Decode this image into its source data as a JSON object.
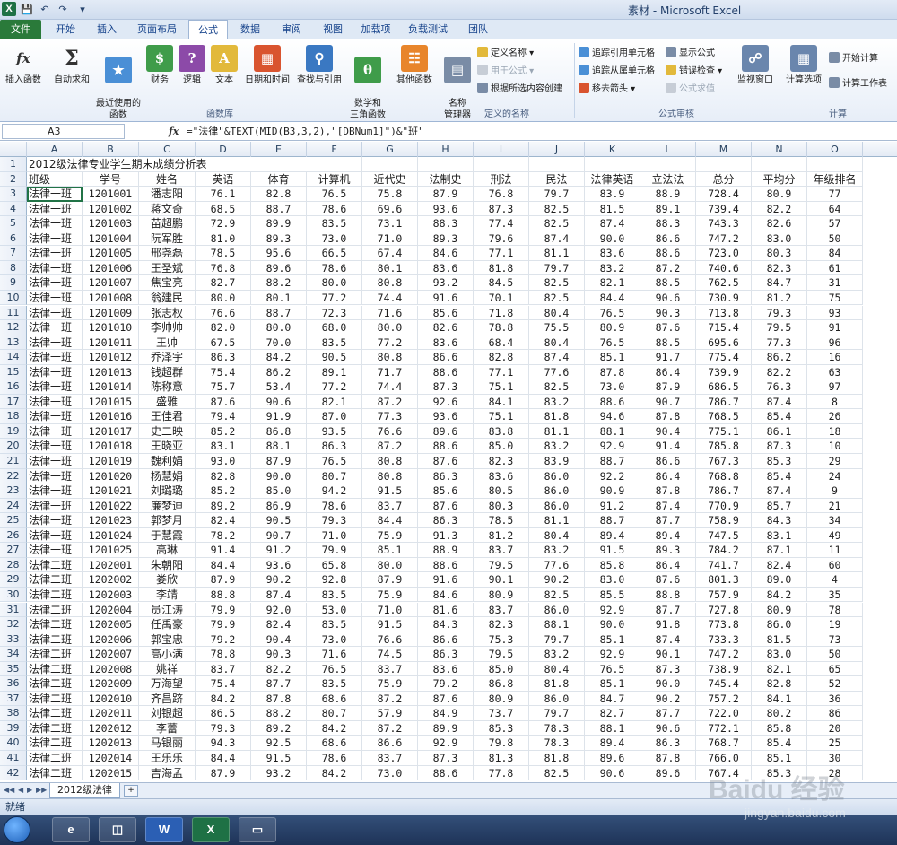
{
  "window": {
    "title": "素材 - Microsoft Excel"
  },
  "tabs": [
    "文件",
    "开始",
    "插入",
    "页面布局",
    "公式",
    "数据",
    "审阅",
    "视图",
    "加载项",
    "负载测试",
    "团队"
  ],
  "active_tab": "公式",
  "ribbon": {
    "big_buttons": [
      {
        "label": "插入函数",
        "icon": "fx-icon"
      },
      {
        "label": "自动求和",
        "icon": "sigma-icon"
      },
      {
        "label": "最近使用的\n函数",
        "icon": "star-book-icon"
      },
      {
        "label": "财务",
        "icon": "finance-book-icon"
      },
      {
        "label": "逻辑",
        "icon": "logic-book-icon"
      },
      {
        "label": "文本",
        "icon": "text-book-icon"
      },
      {
        "label": "日期和时间",
        "icon": "date-book-icon"
      },
      {
        "label": "查找与引用",
        "icon": "lookup-book-icon"
      },
      {
        "label": "数学和\n三角函数",
        "icon": "math-book-icon"
      },
      {
        "label": "其他函数",
        "icon": "more-book-icon"
      },
      {
        "label": "名称\n管理器",
        "icon": "name-manager-icon"
      },
      {
        "label": "监视窗口",
        "icon": "watch-window-icon"
      },
      {
        "label": "计算选项",
        "icon": "calc-options-icon"
      }
    ],
    "small_buttons": {
      "define_name": "定义名称",
      "use_in_formula": "用于公式",
      "create_from_selection": "根据所选内容创建",
      "trace_precedents": "追踪引用单元格",
      "trace_dependents": "追踪从属单元格",
      "remove_arrows": "移去箭头",
      "show_formulas": "显示公式",
      "error_checking": "错误检查",
      "evaluate_formula": "公式求值",
      "calc_now": "开始计算",
      "calc_sheet": "计算工作表"
    },
    "groups": [
      "函数库",
      "定义的名称",
      "公式审核",
      "计算"
    ]
  },
  "formula_bar": {
    "name_box": "A3",
    "fx": "fx",
    "formula": "=\"法律\"&TEXT(MID(B3,3,2),\"[DBNum1]\")&\"班\""
  },
  "columns": [
    "A",
    "B",
    "C",
    "D",
    "E",
    "F",
    "G",
    "H",
    "I",
    "J",
    "K",
    "L",
    "M",
    "N",
    "O"
  ],
  "sheet": {
    "title": "2012级法律专业学生期末成绩分析表",
    "headers": [
      "班级",
      "学号",
      "姓名",
      "英语",
      "体育",
      "计算机",
      "近代史",
      "法制史",
      "刑法",
      "民法",
      "法律英语",
      "立法法",
      "总分",
      "平均分",
      "年级排名"
    ],
    "rows": [
      [
        "法律一班",
        "1201001",
        "潘志阳",
        "76.1",
        "82.8",
        "76.5",
        "75.8",
        "87.9",
        "76.8",
        "79.7",
        "83.9",
        "88.9",
        "728.4",
        "80.9",
        "77"
      ],
      [
        "法律一班",
        "1201002",
        "蒋文奇",
        "68.5",
        "88.7",
        "78.6",
        "69.6",
        "93.6",
        "87.3",
        "82.5",
        "81.5",
        "89.1",
        "739.4",
        "82.2",
        "64"
      ],
      [
        "法律一班",
        "1201003",
        "苗超鹏",
        "72.9",
        "89.9",
        "83.5",
        "73.1",
        "88.3",
        "77.4",
        "82.5",
        "87.4",
        "88.3",
        "743.3",
        "82.6",
        "57"
      ],
      [
        "法律一班",
        "1201004",
        "阮军胜",
        "81.0",
        "89.3",
        "73.0",
        "71.0",
        "89.3",
        "79.6",
        "87.4",
        "90.0",
        "86.6",
        "747.2",
        "83.0",
        "50"
      ],
      [
        "法律一班",
        "1201005",
        "邢尧磊",
        "78.5",
        "95.6",
        "66.5",
        "67.4",
        "84.6",
        "77.1",
        "81.1",
        "83.6",
        "88.6",
        "723.0",
        "80.3",
        "84"
      ],
      [
        "法律一班",
        "1201006",
        "王圣斌",
        "76.8",
        "89.6",
        "78.6",
        "80.1",
        "83.6",
        "81.8",
        "79.7",
        "83.2",
        "87.2",
        "740.6",
        "82.3",
        "61"
      ],
      [
        "法律一班",
        "1201007",
        "焦宝亮",
        "82.7",
        "88.2",
        "80.0",
        "80.8",
        "93.2",
        "84.5",
        "82.5",
        "82.1",
        "88.5",
        "762.5",
        "84.7",
        "31"
      ],
      [
        "法律一班",
        "1201008",
        "翁建民",
        "80.0",
        "80.1",
        "77.2",
        "74.4",
        "91.6",
        "70.1",
        "82.5",
        "84.4",
        "90.6",
        "730.9",
        "81.2",
        "75"
      ],
      [
        "法律一班",
        "1201009",
        "张志权",
        "76.6",
        "88.7",
        "72.3",
        "71.6",
        "85.6",
        "71.8",
        "80.4",
        "76.5",
        "90.3",
        "713.8",
        "79.3",
        "93"
      ],
      [
        "法律一班",
        "1201010",
        "李帅帅",
        "82.0",
        "80.0",
        "68.0",
        "80.0",
        "82.6",
        "78.8",
        "75.5",
        "80.9",
        "87.6",
        "715.4",
        "79.5",
        "91"
      ],
      [
        "法律一班",
        "1201011",
        "王帅",
        "67.5",
        "70.0",
        "83.5",
        "77.2",
        "83.6",
        "68.4",
        "80.4",
        "76.5",
        "88.5",
        "695.6",
        "77.3",
        "96"
      ],
      [
        "法律一班",
        "1201012",
        "乔泽宇",
        "86.3",
        "84.2",
        "90.5",
        "80.8",
        "86.6",
        "82.8",
        "87.4",
        "85.1",
        "91.7",
        "775.4",
        "86.2",
        "16"
      ],
      [
        "法律一班",
        "1201013",
        "钱超群",
        "75.4",
        "86.2",
        "89.1",
        "71.7",
        "88.6",
        "77.1",
        "77.6",
        "87.8",
        "86.4",
        "739.9",
        "82.2",
        "63"
      ],
      [
        "法律一班",
        "1201014",
        "陈称意",
        "75.7",
        "53.4",
        "77.2",
        "74.4",
        "87.3",
        "75.1",
        "82.5",
        "73.0",
        "87.9",
        "686.5",
        "76.3",
        "97"
      ],
      [
        "法律一班",
        "1201015",
        "盛雅",
        "87.6",
        "90.6",
        "82.1",
        "87.2",
        "92.6",
        "84.1",
        "83.2",
        "88.6",
        "90.7",
        "786.7",
        "87.4",
        "8"
      ],
      [
        "法律一班",
        "1201016",
        "王佳君",
        "79.4",
        "91.9",
        "87.0",
        "77.3",
        "93.6",
        "75.1",
        "81.8",
        "94.6",
        "87.8",
        "768.5",
        "85.4",
        "26"
      ],
      [
        "法律一班",
        "1201017",
        "史二映",
        "85.2",
        "86.8",
        "93.5",
        "76.6",
        "89.6",
        "83.8",
        "81.1",
        "88.1",
        "90.4",
        "775.1",
        "86.1",
        "18"
      ],
      [
        "法律一班",
        "1201018",
        "王晓亚",
        "83.1",
        "88.1",
        "86.3",
        "87.2",
        "88.6",
        "85.0",
        "83.2",
        "92.9",
        "91.4",
        "785.8",
        "87.3",
        "10"
      ],
      [
        "法律一班",
        "1201019",
        "魏利娟",
        "93.0",
        "87.9",
        "76.5",
        "80.8",
        "87.6",
        "82.3",
        "83.9",
        "88.7",
        "86.6",
        "767.3",
        "85.3",
        "29"
      ],
      [
        "法律一班",
        "1201020",
        "杨慧娟",
        "82.8",
        "90.0",
        "80.7",
        "80.8",
        "86.3",
        "83.6",
        "86.0",
        "92.2",
        "86.4",
        "768.8",
        "85.4",
        "24"
      ],
      [
        "法律一班",
        "1201021",
        "刘璐璐",
        "85.2",
        "85.0",
        "94.2",
        "91.5",
        "85.6",
        "80.5",
        "86.0",
        "90.9",
        "87.8",
        "786.7",
        "87.4",
        "9"
      ],
      [
        "法律一班",
        "1201022",
        "廉梦迪",
        "89.2",
        "86.9",
        "78.6",
        "83.7",
        "87.6",
        "80.3",
        "86.0",
        "91.2",
        "87.4",
        "770.9",
        "85.7",
        "21"
      ],
      [
        "法律一班",
        "1201023",
        "郭梦月",
        "82.4",
        "90.5",
        "79.3",
        "84.4",
        "86.3",
        "78.5",
        "81.1",
        "88.7",
        "87.7",
        "758.9",
        "84.3",
        "34"
      ],
      [
        "法律一班",
        "1201024",
        "于慧霞",
        "78.2",
        "90.7",
        "71.0",
        "75.9",
        "91.3",
        "81.2",
        "80.4",
        "89.4",
        "89.4",
        "747.5",
        "83.1",
        "49"
      ],
      [
        "法律一班",
        "1201025",
        "高琳",
        "91.4",
        "91.2",
        "79.9",
        "85.1",
        "88.9",
        "83.7",
        "83.2",
        "91.5",
        "89.3",
        "784.2",
        "87.1",
        "11"
      ],
      [
        "法律二班",
        "1202001",
        "朱朝阳",
        "84.4",
        "93.6",
        "65.8",
        "80.0",
        "88.6",
        "79.5",
        "77.6",
        "85.8",
        "86.4",
        "741.7",
        "82.4",
        "60"
      ],
      [
        "法律二班",
        "1202002",
        "娄欣",
        "87.9",
        "90.2",
        "92.8",
        "87.9",
        "91.6",
        "90.1",
        "90.2",
        "83.0",
        "87.6",
        "801.3",
        "89.0",
        "4"
      ],
      [
        "法律二班",
        "1202003",
        "李靖",
        "88.8",
        "87.4",
        "83.5",
        "75.9",
        "84.6",
        "80.9",
        "82.5",
        "85.5",
        "88.8",
        "757.9",
        "84.2",
        "35"
      ],
      [
        "法律二班",
        "1202004",
        "员江涛",
        "79.9",
        "92.0",
        "53.0",
        "71.0",
        "81.6",
        "83.7",
        "86.0",
        "92.9",
        "87.7",
        "727.8",
        "80.9",
        "78"
      ],
      [
        "法律二班",
        "1202005",
        "任禹豪",
        "79.9",
        "82.4",
        "83.5",
        "91.5",
        "84.3",
        "82.3",
        "88.1",
        "90.0",
        "91.8",
        "773.8",
        "86.0",
        "19"
      ],
      [
        "法律二班",
        "1202006",
        "郭宝忠",
        "79.2",
        "90.4",
        "73.0",
        "76.6",
        "86.6",
        "75.3",
        "79.7",
        "85.1",
        "87.4",
        "733.3",
        "81.5",
        "73"
      ],
      [
        "法律二班",
        "1202007",
        "高小满",
        "78.8",
        "90.3",
        "71.6",
        "74.5",
        "86.3",
        "79.5",
        "83.2",
        "92.9",
        "90.1",
        "747.2",
        "83.0",
        "50"
      ],
      [
        "法律二班",
        "1202008",
        "姚祥",
        "83.7",
        "82.2",
        "76.5",
        "83.7",
        "83.6",
        "85.0",
        "80.4",
        "76.5",
        "87.3",
        "738.9",
        "82.1",
        "65"
      ],
      [
        "法律二班",
        "1202009",
        "万海望",
        "75.4",
        "87.7",
        "83.5",
        "75.9",
        "79.2",
        "86.8",
        "81.8",
        "85.1",
        "90.0",
        "745.4",
        "82.8",
        "52"
      ],
      [
        "法律二班",
        "1202010",
        "齐昌跻",
        "84.2",
        "87.8",
        "68.6",
        "87.2",
        "87.6",
        "80.9",
        "86.0",
        "84.7",
        "90.2",
        "757.2",
        "84.1",
        "36"
      ],
      [
        "法律二班",
        "1202011",
        "刘银超",
        "86.5",
        "88.2",
        "80.7",
        "57.9",
        "84.9",
        "73.7",
        "79.7",
        "82.7",
        "87.7",
        "722.0",
        "80.2",
        "86"
      ],
      [
        "法律二班",
        "1202012",
        "李蕾",
        "79.3",
        "89.2",
        "84.2",
        "87.2",
        "89.9",
        "85.3",
        "78.3",
        "88.1",
        "90.6",
        "772.1",
        "85.8",
        "20"
      ],
      [
        "法律二班",
        "1202013",
        "马银丽",
        "94.3",
        "92.5",
        "68.6",
        "86.6",
        "92.9",
        "79.8",
        "78.3",
        "89.4",
        "86.3",
        "768.7",
        "85.4",
        "25"
      ],
      [
        "法律二班",
        "1202014",
        "王乐乐",
        "84.4",
        "91.5",
        "78.6",
        "83.7",
        "87.3",
        "81.3",
        "81.8",
        "89.6",
        "87.8",
        "766.0",
        "85.1",
        "30"
      ],
      [
        "法律二班",
        "1202015",
        "吉海孟",
        "87.9",
        "93.2",
        "84.2",
        "73.0",
        "88.6",
        "77.8",
        "82.5",
        "90.6",
        "89.6",
        "767.4",
        "85.3",
        "28"
      ]
    ]
  },
  "sheet_tab": "2012级法律",
  "status": "就绪",
  "taskbar": [
    "internet-explorer-icon",
    "file-explorer-icon",
    "word-icon",
    "excel-icon",
    "window-icon"
  ],
  "watermark": {
    "brand": "Baidu 经验",
    "url": "jingyan.baidu.com"
  }
}
